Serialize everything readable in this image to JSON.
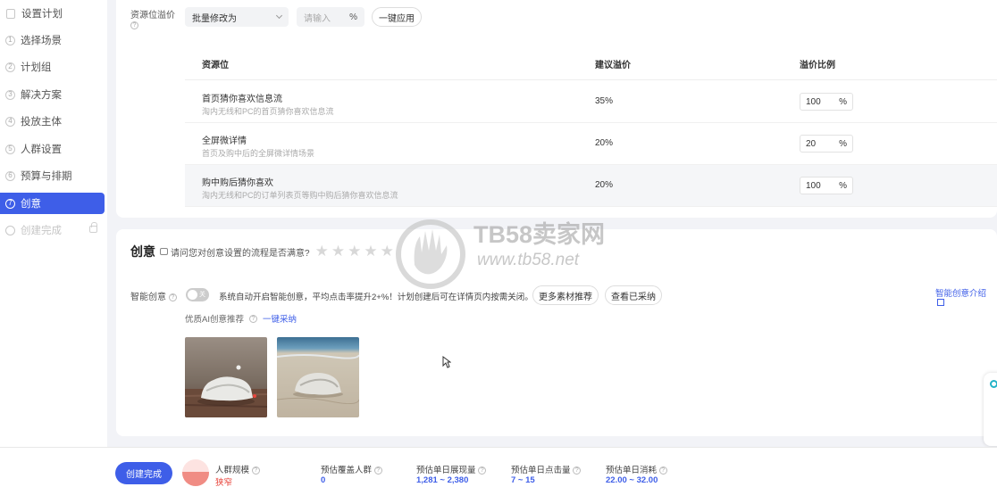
{
  "sidebar": {
    "items": [
      {
        "label": "设置计划",
        "marker": ""
      },
      {
        "label": "选择场景",
        "marker": "1"
      },
      {
        "label": "计划组",
        "marker": "2"
      },
      {
        "label": "解决方案",
        "marker": "3"
      },
      {
        "label": "投放主体",
        "marker": "4"
      },
      {
        "label": "人群设置",
        "marker": "5"
      },
      {
        "label": "预算与排期",
        "marker": "6"
      },
      {
        "label": "创意",
        "marker": "7"
      },
      {
        "label": "创建完成",
        "marker": ""
      }
    ]
  },
  "premium": {
    "label": "资源位溢价",
    "batch_select": "批量修改为",
    "input_placeholder": "请输入",
    "unit": "%",
    "apply_button": "一键应用",
    "columns": [
      "资源位",
      "建议溢价",
      "溢价比例"
    ],
    "rows": [
      {
        "title": "首页猜你喜欢信息流",
        "desc": "淘内无线和PC的首页猜你喜欢信息流",
        "suggest": "35%",
        "ratio": "100",
        "unit": "%"
      },
      {
        "title": "全屏微详情",
        "desc": "首页及购中后的全屏微详情场景",
        "suggest": "20%",
        "ratio": "20",
        "unit": "%"
      },
      {
        "title": "购中购后猜你喜欢",
        "desc": "淘内无线和PC的订单列表页等购中购后猜你喜欢信息流",
        "suggest": "20%",
        "ratio": "100",
        "unit": "%"
      }
    ]
  },
  "creative": {
    "title": "创意",
    "survey": "请问您对创意设置的流程是否满意?",
    "stars": [
      "★",
      "★",
      "★",
      "★",
      "★"
    ],
    "smart_label": "智能创意",
    "toggle_text": "关",
    "smart_desc": "系统自动开启智能创意，平均点击率提升2+%！计划创建后可在详情页内按需关闭。",
    "more_button": "更多素材推荐",
    "view_button": "查看已采纳",
    "intro_link": "智能创意介绍",
    "ai_label": "优质AI创意推荐",
    "adopt_link": "一键采纳"
  },
  "watermark": {
    "brand": "TB58卖家网",
    "url": "www.tb58.net"
  },
  "footer": {
    "create_button": "创建完成",
    "audience_label": "人群规模",
    "audience_value": "狭窄",
    "stats": [
      {
        "label": "预估覆盖人群",
        "value": "0"
      },
      {
        "label": "预估单日展现量",
        "value": "1,281 ~ 2,380"
      },
      {
        "label": "预估单日点击量",
        "value": "7 ~ 15"
      },
      {
        "label": "预估单日消耗",
        "value": "22.00 ~ 32.00"
      }
    ]
  },
  "colors": {
    "accent": "#3e5ee8",
    "danger": "#e8453c"
  }
}
